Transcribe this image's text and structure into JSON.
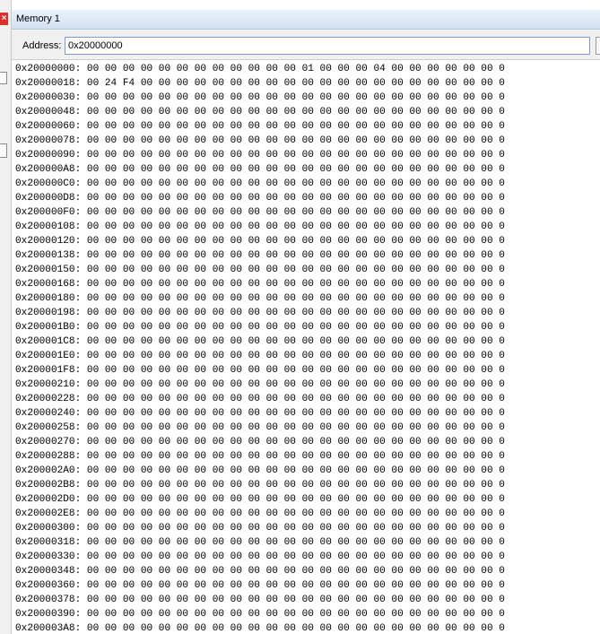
{
  "window": {
    "title": "Memory 1",
    "close_glyph": "×"
  },
  "toolbar": {
    "address_label": "Address:",
    "address_value": "0x20000000"
  },
  "memory": {
    "rows": [
      {
        "addr": "0x20000000:",
        "bytes": "00 00 00 00 00 00 00 00 00 00 00 00 01 00 00 00 04 00 00 00 00 00 00 0"
      },
      {
        "addr": "0x20000018:",
        "bytes": "00 24 F4 00 00 00 00 00 00 00 00 00 00 00 00 00 00 00 00 00 00 00 00 0"
      },
      {
        "addr": "0x20000030:",
        "bytes": "00 00 00 00 00 00 00 00 00 00 00 00 00 00 00 00 00 00 00 00 00 00 00 0"
      },
      {
        "addr": "0x20000048:",
        "bytes": "00 00 00 00 00 00 00 00 00 00 00 00 00 00 00 00 00 00 00 00 00 00 00 0"
      },
      {
        "addr": "0x20000060:",
        "bytes": "00 00 00 00 00 00 00 00 00 00 00 00 00 00 00 00 00 00 00 00 00 00 00 0"
      },
      {
        "addr": "0x20000078:",
        "bytes": "00 00 00 00 00 00 00 00 00 00 00 00 00 00 00 00 00 00 00 00 00 00 00 0"
      },
      {
        "addr": "0x20000090:",
        "bytes": "00 00 00 00 00 00 00 00 00 00 00 00 00 00 00 00 00 00 00 00 00 00 00 0"
      },
      {
        "addr": "0x200000A8:",
        "bytes": "00 00 00 00 00 00 00 00 00 00 00 00 00 00 00 00 00 00 00 00 00 00 00 0"
      },
      {
        "addr": "0x200000C0:",
        "bytes": "00 00 00 00 00 00 00 00 00 00 00 00 00 00 00 00 00 00 00 00 00 00 00 0"
      },
      {
        "addr": "0x200000D8:",
        "bytes": "00 00 00 00 00 00 00 00 00 00 00 00 00 00 00 00 00 00 00 00 00 00 00 0"
      },
      {
        "addr": "0x200000F0:",
        "bytes": "00 00 00 00 00 00 00 00 00 00 00 00 00 00 00 00 00 00 00 00 00 00 00 0"
      },
      {
        "addr": "0x20000108:",
        "bytes": "00 00 00 00 00 00 00 00 00 00 00 00 00 00 00 00 00 00 00 00 00 00 00 0"
      },
      {
        "addr": "0x20000120:",
        "bytes": "00 00 00 00 00 00 00 00 00 00 00 00 00 00 00 00 00 00 00 00 00 00 00 0"
      },
      {
        "addr": "0x20000138:",
        "bytes": "00 00 00 00 00 00 00 00 00 00 00 00 00 00 00 00 00 00 00 00 00 00 00 0"
      },
      {
        "addr": "0x20000150:",
        "bytes": "00 00 00 00 00 00 00 00 00 00 00 00 00 00 00 00 00 00 00 00 00 00 00 0"
      },
      {
        "addr": "0x20000168:",
        "bytes": "00 00 00 00 00 00 00 00 00 00 00 00 00 00 00 00 00 00 00 00 00 00 00 0"
      },
      {
        "addr": "0x20000180:",
        "bytes": "00 00 00 00 00 00 00 00 00 00 00 00 00 00 00 00 00 00 00 00 00 00 00 0"
      },
      {
        "addr": "0x20000198:",
        "bytes": "00 00 00 00 00 00 00 00 00 00 00 00 00 00 00 00 00 00 00 00 00 00 00 0"
      },
      {
        "addr": "0x200001B0:",
        "bytes": "00 00 00 00 00 00 00 00 00 00 00 00 00 00 00 00 00 00 00 00 00 00 00 0"
      },
      {
        "addr": "0x200001C8:",
        "bytes": "00 00 00 00 00 00 00 00 00 00 00 00 00 00 00 00 00 00 00 00 00 00 00 0"
      },
      {
        "addr": "0x200001E0:",
        "bytes": "00 00 00 00 00 00 00 00 00 00 00 00 00 00 00 00 00 00 00 00 00 00 00 0"
      },
      {
        "addr": "0x200001F8:",
        "bytes": "00 00 00 00 00 00 00 00 00 00 00 00 00 00 00 00 00 00 00 00 00 00 00 0"
      },
      {
        "addr": "0x20000210:",
        "bytes": "00 00 00 00 00 00 00 00 00 00 00 00 00 00 00 00 00 00 00 00 00 00 00 0"
      },
      {
        "addr": "0x20000228:",
        "bytes": "00 00 00 00 00 00 00 00 00 00 00 00 00 00 00 00 00 00 00 00 00 00 00 0"
      },
      {
        "addr": "0x20000240:",
        "bytes": "00 00 00 00 00 00 00 00 00 00 00 00 00 00 00 00 00 00 00 00 00 00 00 0"
      },
      {
        "addr": "0x20000258:",
        "bytes": "00 00 00 00 00 00 00 00 00 00 00 00 00 00 00 00 00 00 00 00 00 00 00 0"
      },
      {
        "addr": "0x20000270:",
        "bytes": "00 00 00 00 00 00 00 00 00 00 00 00 00 00 00 00 00 00 00 00 00 00 00 0"
      },
      {
        "addr": "0x20000288:",
        "bytes": "00 00 00 00 00 00 00 00 00 00 00 00 00 00 00 00 00 00 00 00 00 00 00 0"
      },
      {
        "addr": "0x200002A0:",
        "bytes": "00 00 00 00 00 00 00 00 00 00 00 00 00 00 00 00 00 00 00 00 00 00 00 0"
      },
      {
        "addr": "0x200002B8:",
        "bytes": "00 00 00 00 00 00 00 00 00 00 00 00 00 00 00 00 00 00 00 00 00 00 00 0"
      },
      {
        "addr": "0x200002D0:",
        "bytes": "00 00 00 00 00 00 00 00 00 00 00 00 00 00 00 00 00 00 00 00 00 00 00 0"
      },
      {
        "addr": "0x200002E8:",
        "bytes": "00 00 00 00 00 00 00 00 00 00 00 00 00 00 00 00 00 00 00 00 00 00 00 0"
      },
      {
        "addr": "0x20000300:",
        "bytes": "00 00 00 00 00 00 00 00 00 00 00 00 00 00 00 00 00 00 00 00 00 00 00 0"
      },
      {
        "addr": "0x20000318:",
        "bytes": "00 00 00 00 00 00 00 00 00 00 00 00 00 00 00 00 00 00 00 00 00 00 00 0"
      },
      {
        "addr": "0x20000330:",
        "bytes": "00 00 00 00 00 00 00 00 00 00 00 00 00 00 00 00 00 00 00 00 00 00 00 0"
      },
      {
        "addr": "0x20000348:",
        "bytes": "00 00 00 00 00 00 00 00 00 00 00 00 00 00 00 00 00 00 00 00 00 00 00 0"
      },
      {
        "addr": "0x20000360:",
        "bytes": "00 00 00 00 00 00 00 00 00 00 00 00 00 00 00 00 00 00 00 00 00 00 00 0"
      },
      {
        "addr": "0x20000378:",
        "bytes": "00 00 00 00 00 00 00 00 00 00 00 00 00 00 00 00 00 00 00 00 00 00 00 0"
      },
      {
        "addr": "0x20000390:",
        "bytes": "00 00 00 00 00 00 00 00 00 00 00 00 00 00 00 00 00 00 00 00 00 00 00 0"
      },
      {
        "addr": "0x200003A8:",
        "bytes": "00 00 00 00 00 00 00 00 00 00 00 00 00 00 00 00 00 00 00 00 00 00 00 0"
      }
    ]
  }
}
